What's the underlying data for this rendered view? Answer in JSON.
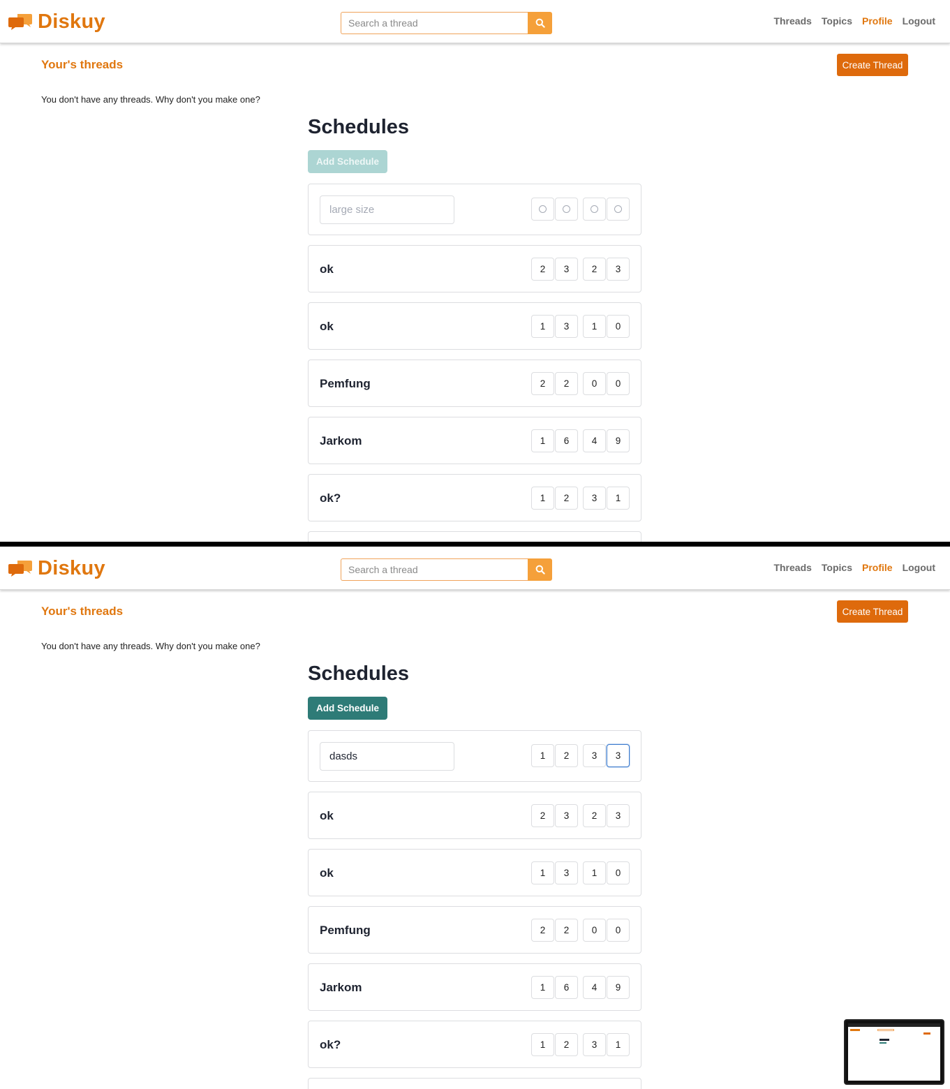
{
  "brand": {
    "name": "Diskuy",
    "color": "#e0770f"
  },
  "search": {
    "placeholder": "Search a thread",
    "icon": "search-icon"
  },
  "nav": {
    "links": [
      {
        "label": "Threads",
        "active": false
      },
      {
        "label": "Topics",
        "active": false
      },
      {
        "label": "Profile",
        "active": true
      },
      {
        "label": "Logout",
        "active": false
      }
    ]
  },
  "threads": {
    "title": "Your's threads",
    "create_label": "Create Thread",
    "empty_message": "You don't have any threads. Why don't you make one?"
  },
  "schedules": {
    "heading": "Schedules",
    "add_label": "Add Schedule",
    "name_placeholder": "large size",
    "rows": [
      {
        "name": "ok",
        "values": [
          "2",
          "3",
          "2",
          "3"
        ]
      },
      {
        "name": "ok",
        "values": [
          "1",
          "3",
          "1",
          "0"
        ]
      },
      {
        "name": "Pemfung",
        "values": [
          "2",
          "2",
          "0",
          "0"
        ]
      },
      {
        "name": "Jarkom",
        "values": [
          "1",
          "6",
          "4",
          "9"
        ]
      },
      {
        "name": "ok?",
        "values": [
          "1",
          "2",
          "3",
          "1"
        ]
      }
    ]
  },
  "states": [
    {
      "add_enabled": false,
      "new_name": "",
      "new_values": [
        "",
        "",
        "",
        ""
      ]
    },
    {
      "add_enabled": true,
      "new_name": "dasds",
      "new_values": [
        "1",
        "2",
        "3",
        "3"
      ]
    }
  ],
  "colors": {
    "accent": "#e0770f",
    "create_button": "#de6a0c",
    "search_button": "#f5a03a",
    "teal": "#2e7b77",
    "teal_disabled": "#acd5d3",
    "focus": "#3d7bcc"
  }
}
